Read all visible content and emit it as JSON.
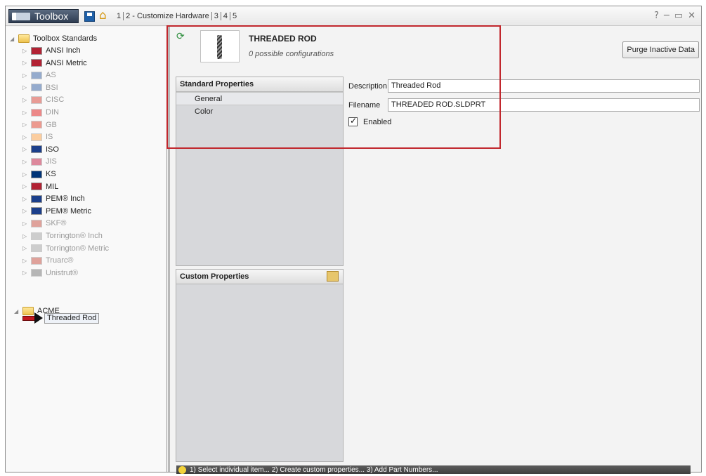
{
  "titlebar": {
    "title": "Toolbox",
    "steps": [
      "1",
      "2 - Customize Hardware",
      "3",
      "4",
      "5"
    ],
    "help_glyph": "?",
    "minimize_glyph": "─",
    "restore_glyph": "▭",
    "close_glyph": "✕"
  },
  "tree": {
    "root_label": "Toolbox Standards",
    "items": [
      {
        "label": "ANSI Inch",
        "flag": "#b22234",
        "dim": false
      },
      {
        "label": "ANSI Metric",
        "flag": "#b22234",
        "dim": false
      },
      {
        "label": "AS",
        "flag": "#1d4e9a",
        "dim": true
      },
      {
        "label": "BSI",
        "flag": "#1d4e9a",
        "dim": true
      },
      {
        "label": "CISC",
        "flag": "#d52b1e",
        "dim": true
      },
      {
        "label": "DIN",
        "flag": "#dd0000",
        "dim": true
      },
      {
        "label": "GB",
        "flag": "#de2910",
        "dim": true
      },
      {
        "label": "IS",
        "flag": "#ff9933",
        "dim": true
      },
      {
        "label": "ISO",
        "flag": "#1b3f8b",
        "dim": false
      },
      {
        "label": "JIS",
        "flag": "#bc002d",
        "dim": true
      },
      {
        "label": "KS",
        "flag": "#003478",
        "dim": false
      },
      {
        "label": "MIL",
        "flag": "#b22234",
        "dim": false
      },
      {
        "label": "PEM® Inch",
        "flag": "#1b3f8b",
        "dim": false
      },
      {
        "label": "PEM® Metric",
        "flag": "#1b3f8b",
        "dim": false
      },
      {
        "label": "SKF®",
        "flag": "#c0392b",
        "dim": true
      },
      {
        "label": "Torrington® Inch",
        "flag": "#999999",
        "dim": true
      },
      {
        "label": "Torrington® Metric",
        "flag": "#999999",
        "dim": true
      },
      {
        "label": "Truarc®",
        "flag": "#c0392b",
        "dim": true
      },
      {
        "label": "Unistrut®",
        "flag": "#666666",
        "dim": true
      }
    ],
    "custom_folder": "ACME",
    "selected_item": "Threaded Rod"
  },
  "part": {
    "title": "THREADED ROD",
    "configurations": "0 possible configurations",
    "purge_label": "Purge Inactive Data"
  },
  "standard_properties": {
    "heading": "Standard Properties",
    "items": [
      "General",
      "Color"
    ]
  },
  "custom_properties": {
    "heading": "Custom Properties"
  },
  "form": {
    "description_label": "Description",
    "description_value": "Threaded Rod",
    "filename_label": "Filename",
    "filename_value": "THREADED ROD.SLDPRT",
    "enabled_label": "Enabled"
  },
  "status": {
    "text": "1) Select individual item... 2) Create custom properties... 3) Add Part Numbers..."
  },
  "colors": {
    "highlight": "#c1272d",
    "pointer_arrow": "#c3191d"
  }
}
